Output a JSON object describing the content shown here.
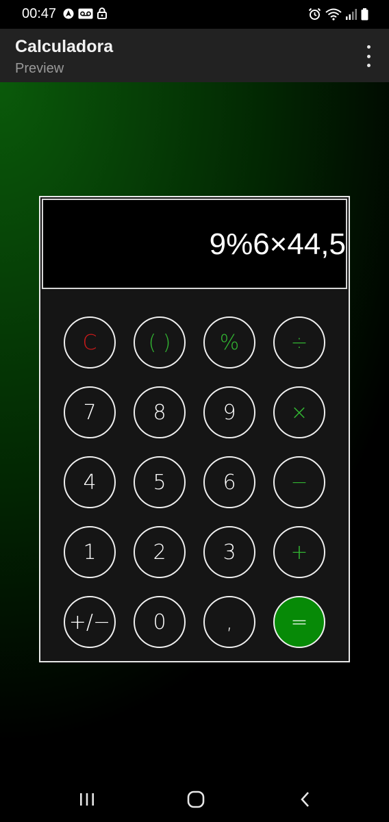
{
  "status_bar": {
    "time": "00:47"
  },
  "app_bar": {
    "title": "Calculadora",
    "subtitle": "Preview"
  },
  "calculator": {
    "display_value": "9%6×44,5",
    "keys": [
      {
        "label": "C",
        "name": "clear-button",
        "style": "red"
      },
      {
        "label": "( )",
        "name": "parentheses-button",
        "style": "green"
      },
      {
        "label": "%",
        "name": "percent-button",
        "style": "green"
      },
      {
        "label": "÷",
        "name": "divide-button",
        "style": "green"
      },
      {
        "label": "7",
        "name": "digit-7-button",
        "style": ""
      },
      {
        "label": "8",
        "name": "digit-8-button",
        "style": ""
      },
      {
        "label": "9",
        "name": "digit-9-button",
        "style": ""
      },
      {
        "label": "×",
        "name": "multiply-button",
        "style": "green"
      },
      {
        "label": "4",
        "name": "digit-4-button",
        "style": ""
      },
      {
        "label": "5",
        "name": "digit-5-button",
        "style": ""
      },
      {
        "label": "6",
        "name": "digit-6-button",
        "style": ""
      },
      {
        "label": "−",
        "name": "subtract-button",
        "style": "green"
      },
      {
        "label": "1",
        "name": "digit-1-button",
        "style": ""
      },
      {
        "label": "2",
        "name": "digit-2-button",
        "style": ""
      },
      {
        "label": "3",
        "name": "digit-3-button",
        "style": ""
      },
      {
        "label": "+",
        "name": "add-button",
        "style": "green"
      },
      {
        "label": "+/−",
        "name": "toggle-sign-button",
        "style": ""
      },
      {
        "label": "0",
        "name": "digit-0-button",
        "style": ""
      },
      {
        "label": ",",
        "name": "decimal-comma-button",
        "style": ""
      },
      {
        "label": "=",
        "name": "equals-button",
        "style": "equals"
      }
    ]
  },
  "colors": {
    "accent_green": "#32b532",
    "equals_green": "#078a07",
    "clear_red": "#cc1a1a",
    "app_bar": "#222222"
  },
  "icons": {
    "status_left": [
      "navigation-icon",
      "voicemail-icon",
      "lock-icon"
    ],
    "status_right": [
      "alarm-icon",
      "wifi-icon",
      "signal-icon",
      "battery-icon"
    ],
    "nav": [
      "recents-icon",
      "home-icon",
      "back-icon"
    ]
  }
}
